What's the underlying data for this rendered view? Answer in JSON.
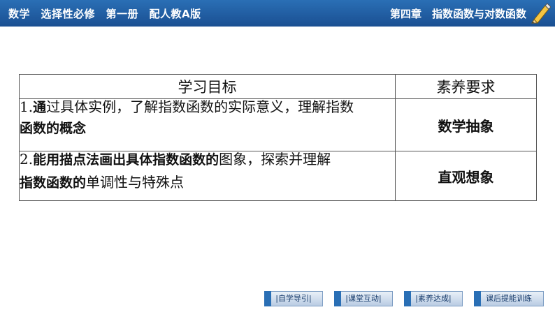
{
  "header": {
    "book_info": "数学　选择性必修　第一册　配人教A版",
    "chapter_info": "第四章　指数函数与对数函数",
    "icon": "pencil-icon",
    "bg_color": "#1a4f92"
  },
  "table": {
    "head_goal": "学习目标",
    "head_literacy": "素养要求",
    "rows": [
      {
        "goal_line1_prefix": "1.",
        "goal_line1_bold": "通",
        "goal_line1_rest": "过具体实例，了解指数函数的实际意义，理解指数",
        "goal_line2": "函数的概念",
        "literacy": "数学抽象"
      },
      {
        "goal_line1_prefix": "2.",
        "goal_line1_bold": "能用描点法画出具体指数函数的",
        "goal_line1_rest": "图象，探索并理解",
        "goal_line2_bold": "指数函数的",
        "goal_line2_rest": "单调性与特殊点",
        "literacy": "直观想象"
      }
    ]
  },
  "nav": {
    "buttons": [
      "|自学导引|",
      "|课堂互动|",
      "|素养达成|",
      "课后提能训练"
    ]
  }
}
